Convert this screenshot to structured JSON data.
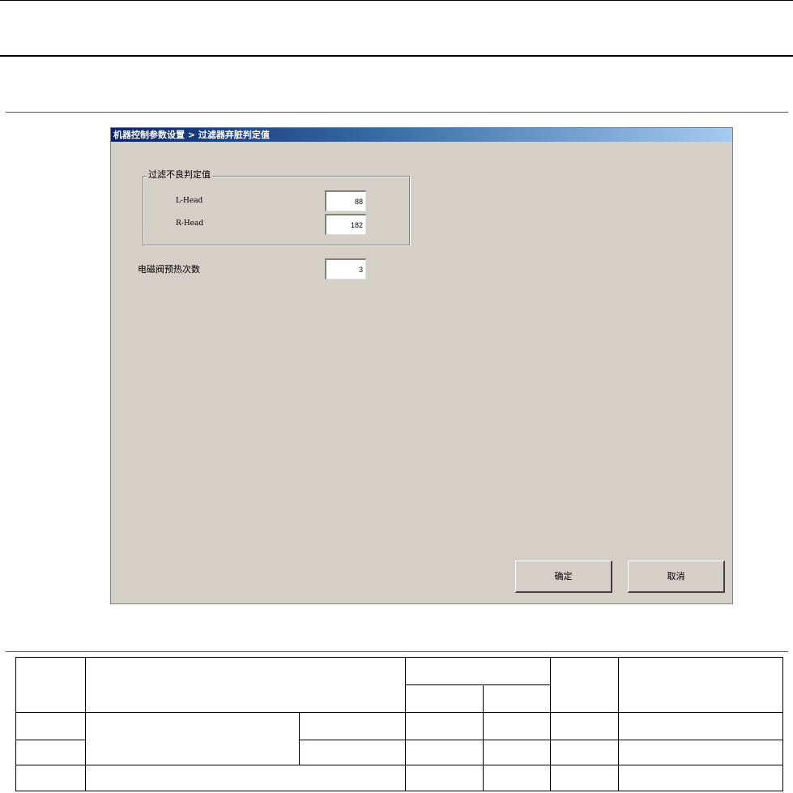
{
  "dialog": {
    "title": "机器控制参数设置 > 过滤器弃脏判定值",
    "group": {
      "label": "过滤不良判定值",
      "fields": [
        {
          "label": "L-Head",
          "value": "88"
        },
        {
          "label": "R-Head",
          "value": "182"
        }
      ]
    },
    "preheat": {
      "label": "电磁阀预热次数",
      "value": "3"
    },
    "buttons": {
      "ok": "确定",
      "cancel": "取消"
    }
  },
  "colors": {
    "dialog_bg": "#d4d0c8",
    "title_start": "#0a246a",
    "title_end": "#a6caf0"
  }
}
